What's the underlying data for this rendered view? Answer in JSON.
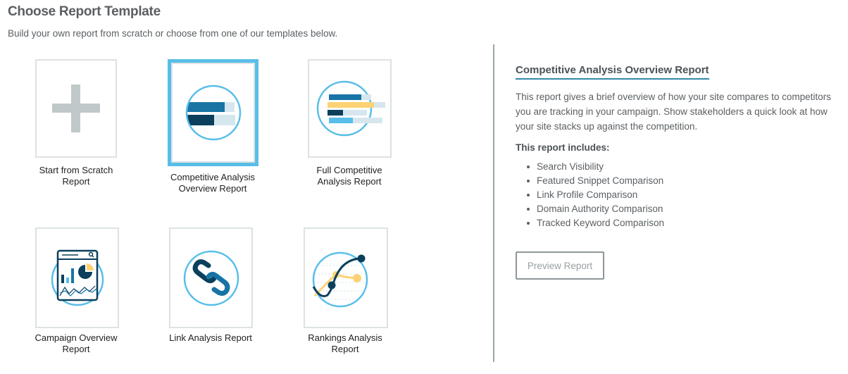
{
  "header": {
    "title": "Choose Report Template",
    "subtitle": "Build your own report from scratch or choose from one of our templates below."
  },
  "templates": [
    {
      "id": "scratch",
      "label_line1": "Start from Scratch",
      "label_line2": "Report",
      "icon": "plus-icon",
      "selected": false
    },
    {
      "id": "competitive-overview",
      "label_line1": "Competitive Analysis",
      "label_line2": "Overview Report",
      "icon": "bar-compare-icon",
      "selected": true
    },
    {
      "id": "full-competitive",
      "label_line1": "Full Competitive",
      "label_line2": "Analysis Report",
      "icon": "multi-bar-icon",
      "selected": false
    },
    {
      "id": "campaign-overview",
      "label_line1": "Campaign Overview",
      "label_line2": "Report",
      "icon": "dashboard-icon",
      "selected": false
    },
    {
      "id": "link-analysis",
      "label_line1": "Link Analysis Report",
      "label_line2": "",
      "icon": "chain-link-icon",
      "selected": false
    },
    {
      "id": "rankings-analysis",
      "label_line1": "Rankings Analysis",
      "label_line2": "Report",
      "icon": "line-chart-icon",
      "selected": false
    }
  ],
  "detail": {
    "title": "Competitive Analysis Overview Report",
    "description": "This report gives a brief overview of how your site compares to competitors you are tracking in your campaign. Show stakeholders a quick look at how your site stacks up against the competition.",
    "includes_title": "This report includes:",
    "includes": [
      "Search Visibility",
      "Featured Snippet Comparison",
      "Link Profile Comparison",
      "Domain Authority Comparison",
      "Tracked Keyword Comparison"
    ],
    "preview_button": "Preview Report"
  },
  "colors": {
    "accent": "#58bee8",
    "title_underline": "#2f89a8",
    "dark_blue": "#0b3f5c",
    "mid_blue": "#1874a5",
    "light_blue": "#d6e6ef",
    "yellow": "#fcd274",
    "plus_gray": "#c1c8ca"
  }
}
